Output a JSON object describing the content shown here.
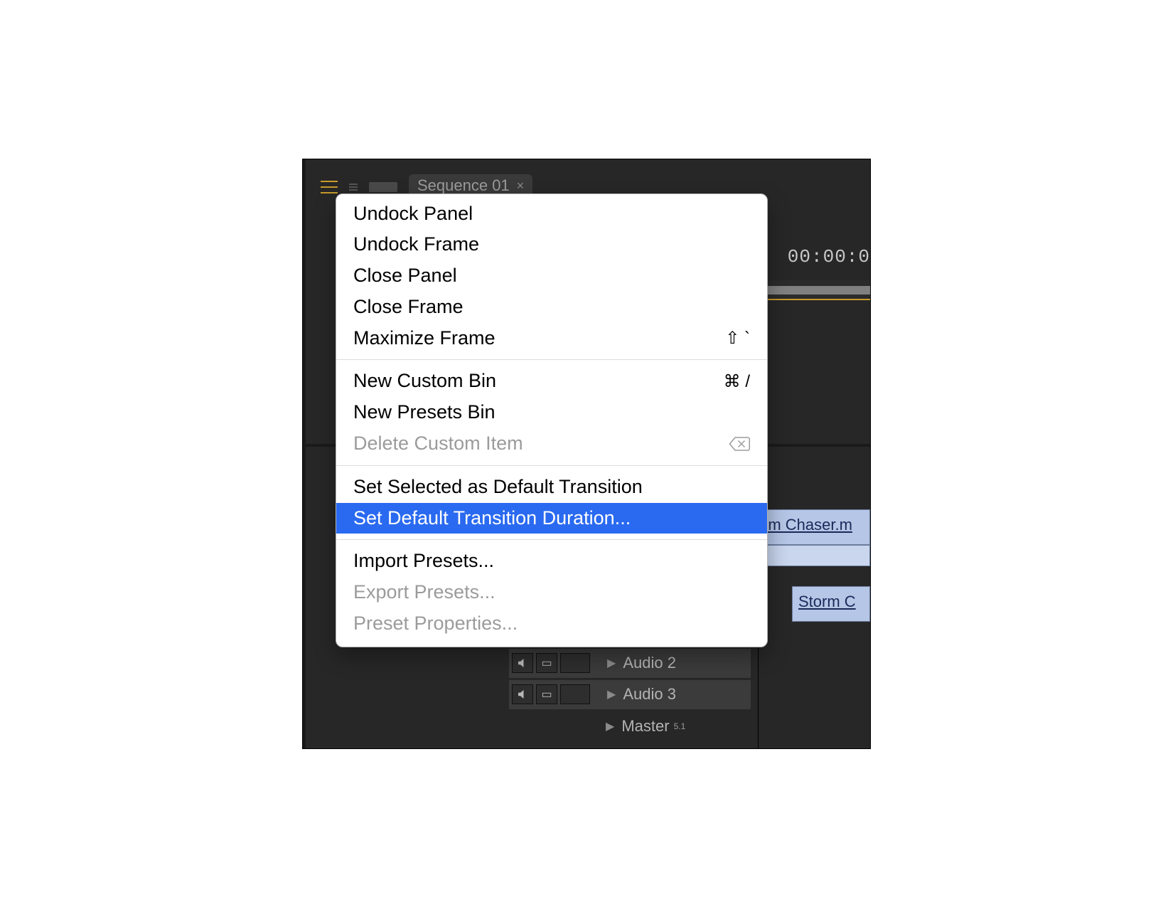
{
  "tab": {
    "title": "Sequence 01"
  },
  "timeline": {
    "timecode_right": "00:00:0",
    "clip1_label": "rm Chaser.m",
    "clip2_label": "Storm C",
    "tracks": {
      "audio2": "Audio 2",
      "audio3": "Audio 3",
      "master": "Master",
      "master_badge": "5.1"
    }
  },
  "menu": {
    "groups": [
      {
        "items": [
          {
            "label": "Undock Panel",
            "enabled": true,
            "shortcut": ""
          },
          {
            "label": "Undock Frame",
            "enabled": true,
            "shortcut": ""
          },
          {
            "label": "Close Panel",
            "enabled": true,
            "shortcut": ""
          },
          {
            "label": "Close Frame",
            "enabled": true,
            "shortcut": ""
          },
          {
            "label": "Maximize Frame",
            "enabled": true,
            "shortcut": "⇧ `"
          }
        ]
      },
      {
        "items": [
          {
            "label": "New Custom Bin",
            "enabled": true,
            "shortcut": "⌘ /"
          },
          {
            "label": "New Presets Bin",
            "enabled": true,
            "shortcut": ""
          },
          {
            "label": "Delete Custom Item",
            "enabled": false,
            "shortcut": "delete"
          }
        ]
      },
      {
        "items": [
          {
            "label": "Set Selected as Default Transition",
            "enabled": true,
            "shortcut": ""
          },
          {
            "label": "Set Default Transition Duration...",
            "enabled": true,
            "shortcut": "",
            "highlight": true
          }
        ]
      },
      {
        "items": [
          {
            "label": "Import Presets...",
            "enabled": true,
            "shortcut": ""
          },
          {
            "label": "Export Presets...",
            "enabled": false,
            "shortcut": ""
          },
          {
            "label": "Preset Properties...",
            "enabled": false,
            "shortcut": ""
          }
        ]
      }
    ]
  }
}
